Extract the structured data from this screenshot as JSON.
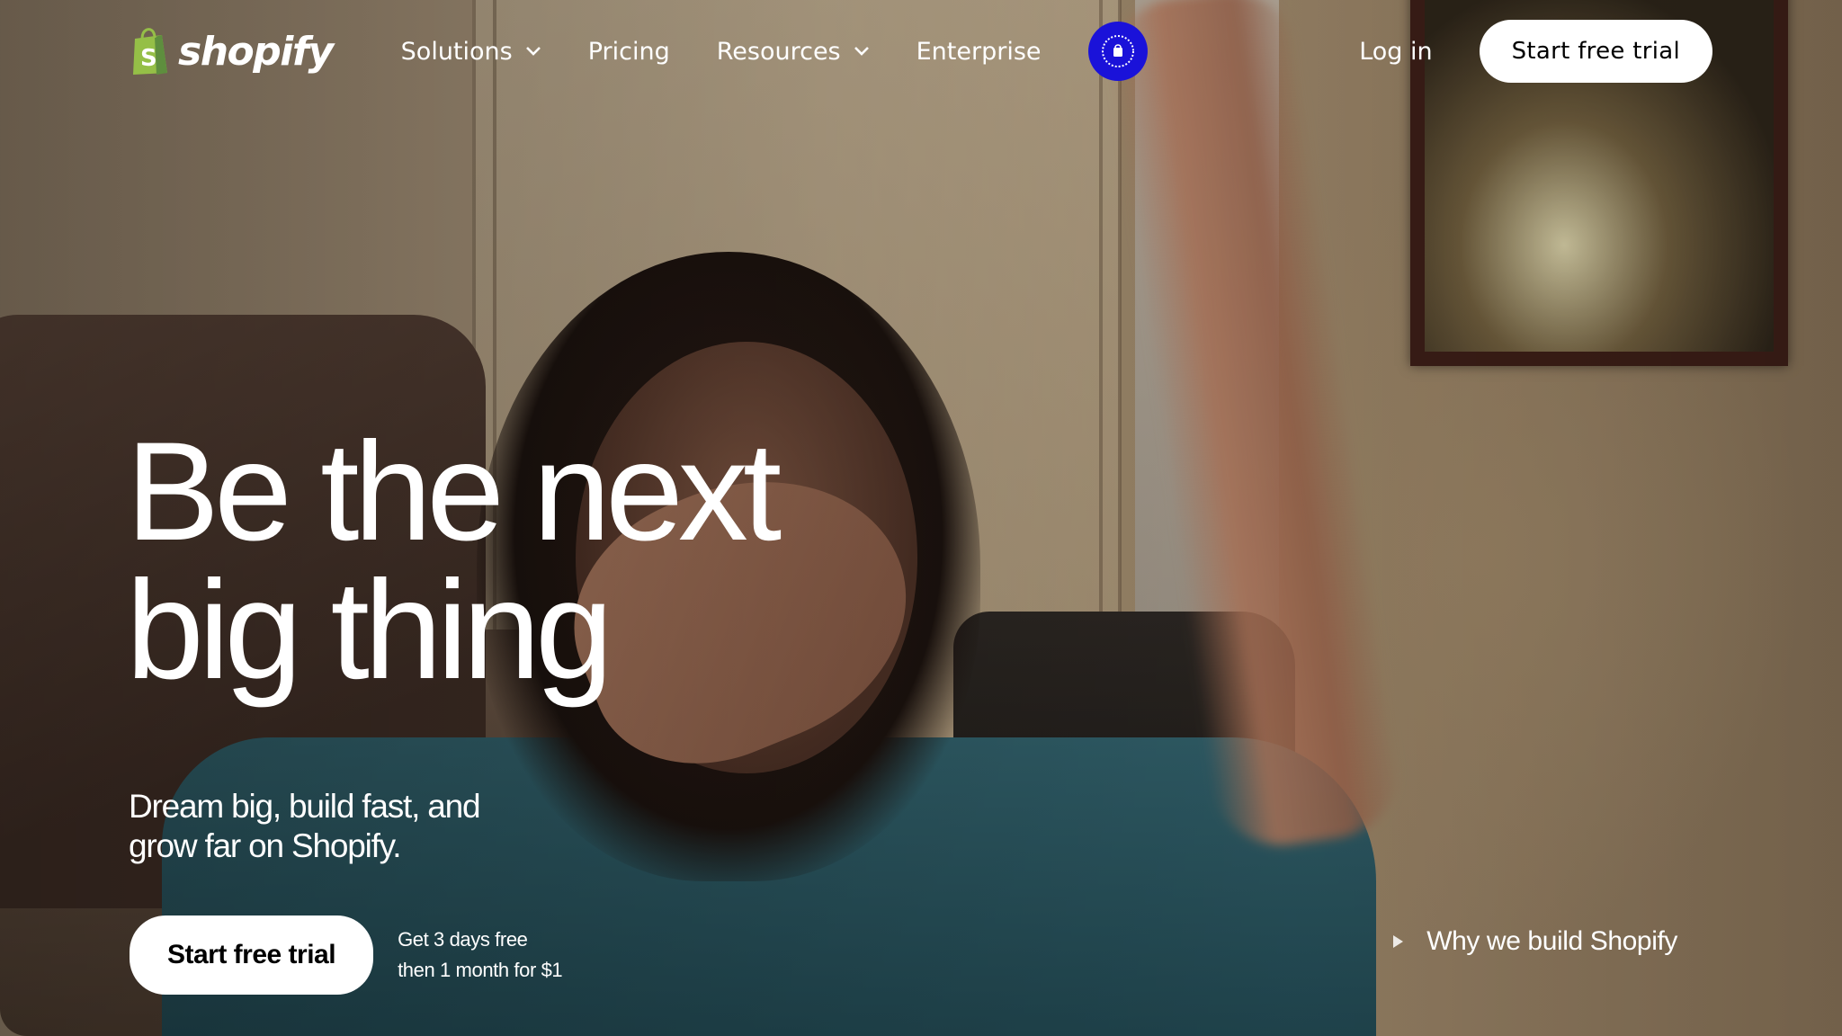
{
  "header": {
    "logo_text": "shopify",
    "nav": [
      {
        "label": "Solutions",
        "has_dropdown": true
      },
      {
        "label": "Pricing",
        "has_dropdown": false
      },
      {
        "label": "Resources",
        "has_dropdown": true
      },
      {
        "label": "Enterprise",
        "has_dropdown": false
      }
    ],
    "badge_icon": "shopify-editions-badge-icon",
    "login_label": "Log in",
    "cta_label": "Start free trial"
  },
  "hero": {
    "headline_line1": "Be the next",
    "headline_line2": "big thing",
    "subhead": "Dream big, build fast, and grow far on Shopify.",
    "cta_label": "Start free trial",
    "offer_line1": "Get 3 days free",
    "offer_line2": "then 1 month for $1",
    "video_link_label": "Why we build Shopify",
    "video_link_icon": "play-icon"
  },
  "colors": {
    "brand_green": "#95bf47",
    "badge_blue": "#1a12d9",
    "button_bg": "#ffffff",
    "button_text": "#000000"
  }
}
